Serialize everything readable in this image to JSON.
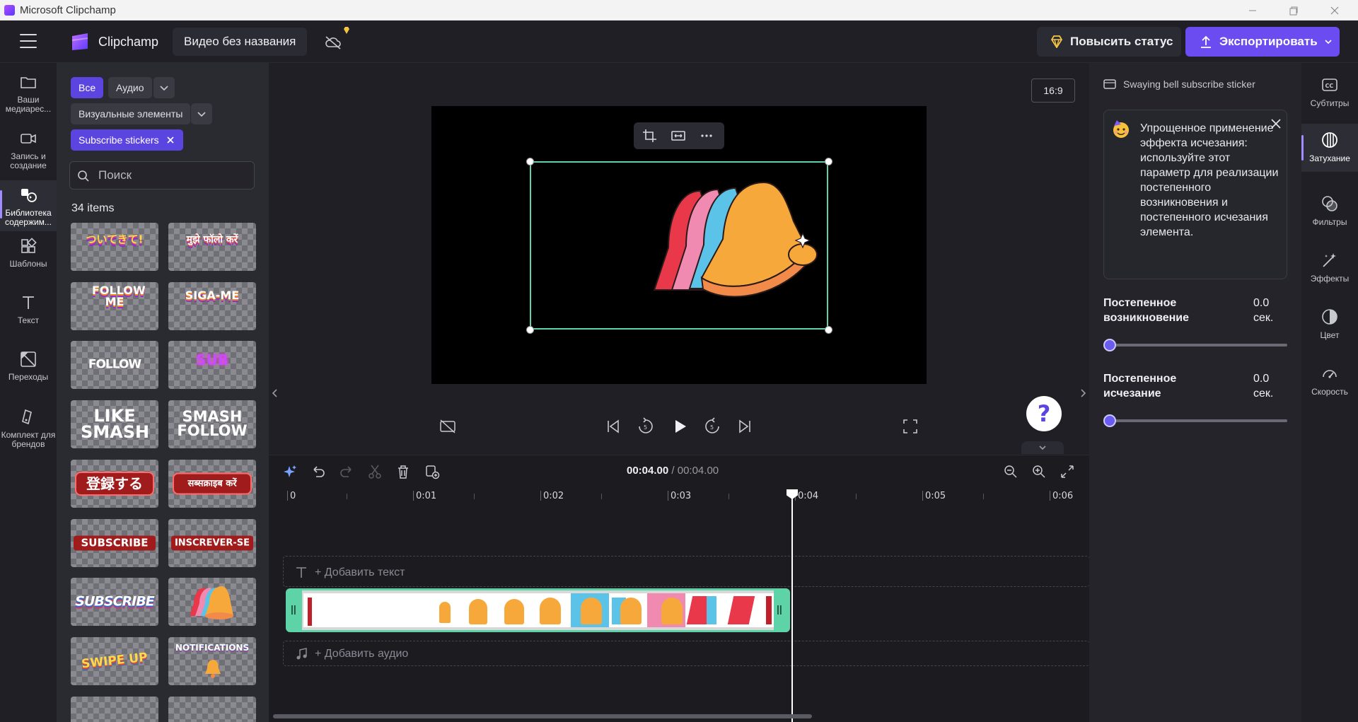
{
  "window": {
    "title": "Microsoft Clipchamp"
  },
  "header": {
    "brand": "Clipchamp",
    "project_title": "Видео без названия",
    "upgrade_label": "Повысить статус",
    "export_label": "Экспортировать"
  },
  "left_nav": {
    "items": [
      {
        "label": "Ваши медиарес...",
        "icon": "folder-icon"
      },
      {
        "label": "Запись и создание",
        "icon": "camera-icon"
      },
      {
        "label": "Библиотека содержим...",
        "icon": "library-icon",
        "active": true
      },
      {
        "label": "Шаблоны",
        "icon": "templates-icon"
      },
      {
        "label": "Текст",
        "icon": "text-icon"
      },
      {
        "label": "Переходы",
        "icon": "transitions-icon"
      },
      {
        "label": "Комплект для брендов",
        "icon": "brand-kit-icon"
      }
    ]
  },
  "library": {
    "filters": {
      "all": "Все",
      "audio": "Аудио",
      "visual": "Визуальные элементы"
    },
    "active_tag": "Subscribe stickers",
    "search_placeholder": "Поиск",
    "count": "34 items",
    "tiles": [
      "ついてきて!",
      "मुझे फॉलो करें",
      "FOLLOW ME",
      "SIGA-ME",
      "FOLLOW",
      "SUB",
      "LIKE SMASH",
      "SMASH FOLLOW",
      "登録する",
      "सब्सक्राइब करें",
      "SUBSCRIBE",
      "INSCREVER-SE",
      "SUBSCRIBE",
      "",
      "SWIPE UP",
      "NOTIFICATIONS"
    ]
  },
  "preview": {
    "aspect_ratio": "16:9",
    "help_label": "?"
  },
  "timeline": {
    "current_time": "00:04.00",
    "separator": " / ",
    "total_time": "00:04.00",
    "ticks": [
      "0",
      "0:01",
      "0:02",
      "0:03",
      "0:04",
      "0:05",
      "0:06"
    ],
    "add_text": "+ Добавить текст",
    "add_audio": "+ Добавить аудио",
    "playhead_seconds": 4.0
  },
  "properties": {
    "title": "Swaying bell subscribe sticker",
    "tip": "Упрощенное применение эффекта исчезания: используйте этот параметр для реализации постепенного возникновения и постепенного исчезания элемента.",
    "fade_in_label": "Постепенное возникновение",
    "fade_in_value": "0.0 сек.",
    "fade_out_label": "Постепенное исчезание",
    "fade_out_value": "0.0 сек.",
    "fade_in_fraction": 0,
    "fade_out_fraction": 0
  },
  "right_rail": {
    "items": [
      {
        "label": "Субтитры",
        "icon": "captions-icon"
      },
      {
        "label": "Затухание",
        "icon": "fade-icon",
        "active": true
      },
      {
        "label": "Фильтры",
        "icon": "filters-icon"
      },
      {
        "label": "Эффекты",
        "icon": "effects-icon"
      },
      {
        "label": "Цвет",
        "icon": "color-icon"
      },
      {
        "label": "Скорость",
        "icon": "speed-icon"
      }
    ]
  },
  "colors": {
    "accent": "#6b4cf0",
    "selection": "#5fd3a8",
    "background": "#1f1f25"
  }
}
